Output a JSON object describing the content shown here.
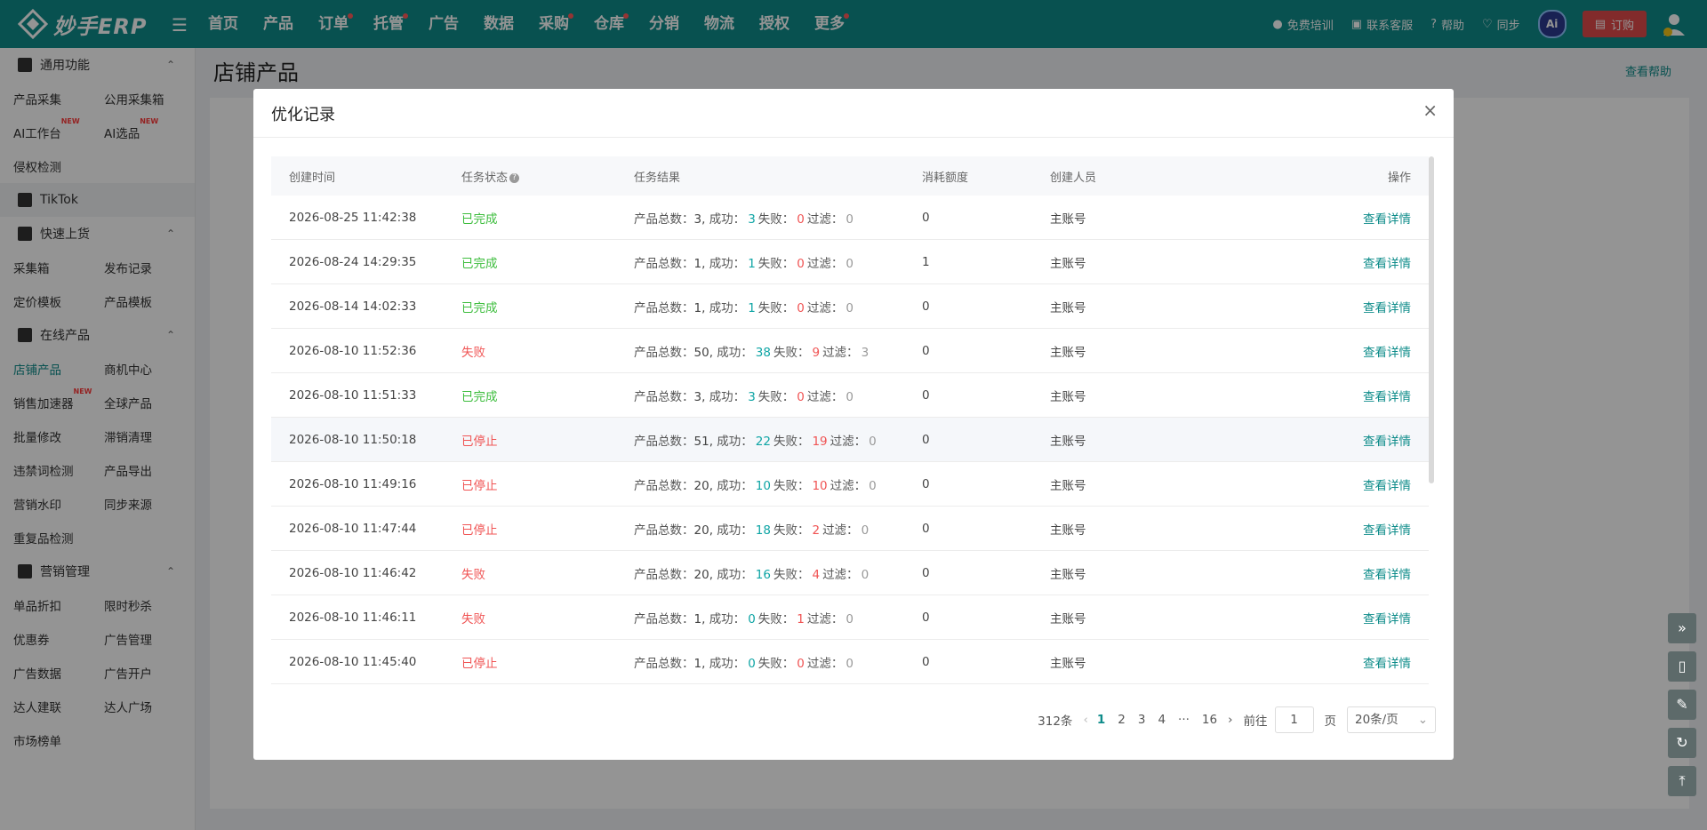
{
  "topbar": {
    "logo_text": "妙手ERP",
    "nav": [
      {
        "label": "首页",
        "dot": false
      },
      {
        "label": "产品",
        "dot": false
      },
      {
        "label": "订单",
        "dot": true
      },
      {
        "label": "托管",
        "dot": true
      },
      {
        "label": "广告",
        "dot": false
      },
      {
        "label": "数据",
        "dot": false
      },
      {
        "label": "采购",
        "dot": true
      },
      {
        "label": "仓库",
        "dot": true
      },
      {
        "label": "分销",
        "dot": false
      },
      {
        "label": "物流",
        "dot": false
      },
      {
        "label": "授权",
        "dot": false
      },
      {
        "label": "更多",
        "dot": true
      }
    ],
    "right": {
      "training": "免费培训",
      "service": "联系客服",
      "help": "帮助",
      "sync": "同步",
      "ai": "Ai",
      "order": "订购"
    }
  },
  "sidebar": {
    "sections": [
      {
        "title": "通用功能",
        "rows": [
          [
            "产品采集",
            "公用采集箱"
          ],
          [
            "AI工作台",
            "AI选品"
          ],
          [
            "侵权检测"
          ]
        ],
        "new": [
          "AI工作台",
          "AI选品"
        ]
      },
      {
        "title": "TikTok",
        "rows": []
      },
      {
        "title": "快速上货",
        "rows": [
          [
            "采集箱",
            "发布记录"
          ],
          [
            "定价模板",
            "产品模板"
          ]
        ]
      },
      {
        "title": "在线产品",
        "rows": [
          [
            "店铺产品",
            "商机中心"
          ],
          [
            "销售加速器",
            "全球产品"
          ],
          [
            "批量修改",
            "滞销清理"
          ],
          [
            "违禁词检测",
            "产品导出"
          ],
          [
            "营销水印",
            "同步来源"
          ],
          [
            "重复品检测"
          ]
        ],
        "new": [
          "销售加速器"
        ]
      },
      {
        "title": "营销管理",
        "rows": [
          [
            "单品折扣",
            "限时秒杀"
          ],
          [
            "优惠券",
            "广告管理"
          ],
          [
            "广告数据",
            "广告开户"
          ],
          [
            "达人建联",
            "达人广场"
          ],
          [
            "市场榜单"
          ]
        ]
      }
    ],
    "active": "店铺产品",
    "new_label": "NEW"
  },
  "page": {
    "title": "店铺产品",
    "help": "查看帮助"
  },
  "modal": {
    "title": "优化记录",
    "headers": {
      "time": "创建时间",
      "status": "任务状态",
      "result": "任务结果",
      "quota": "消耗额度",
      "creator": "创建人员",
      "action": "操作"
    },
    "result_labels": {
      "total": "产品总数：",
      "success": "成功：",
      "fail": "失败：",
      "filter": "过滤："
    },
    "rows": [
      {
        "time": "2026-08-25 11:42:38",
        "status": "已完成",
        "kind": "done",
        "total": "3",
        "success": "3",
        "fail": "0",
        "filter": "0",
        "quota": "0",
        "creator": "主账号",
        "action": "查看详情"
      },
      {
        "time": "2026-08-24 14:29:35",
        "status": "已完成",
        "kind": "done",
        "total": "1",
        "success": "1",
        "fail": "0",
        "filter": "0",
        "quota": "1",
        "creator": "主账号",
        "action": "查看详情"
      },
      {
        "time": "2026-08-14 14:02:33",
        "status": "已完成",
        "kind": "done",
        "total": "1",
        "success": "1",
        "fail": "0",
        "filter": "0",
        "quota": "0",
        "creator": "主账号",
        "action": "查看详情"
      },
      {
        "time": "2026-08-10 11:52:36",
        "status": "失败",
        "kind": "fail",
        "total": "50",
        "success": "38",
        "fail": "9",
        "filter": "3",
        "quota": "0",
        "creator": "主账号",
        "action": "查看详情"
      },
      {
        "time": "2026-08-10 11:51:33",
        "status": "已完成",
        "kind": "done",
        "total": "3",
        "success": "3",
        "fail": "0",
        "filter": "0",
        "quota": "0",
        "creator": "主账号",
        "action": "查看详情"
      },
      {
        "time": "2026-08-10 11:50:18",
        "status": "已停止",
        "kind": "fail",
        "total": "51",
        "success": "22",
        "fail": "19",
        "filter": "0",
        "quota": "0",
        "creator": "主账号",
        "action": "查看详情"
      },
      {
        "time": "2026-08-10 11:49:16",
        "status": "已停止",
        "kind": "fail",
        "total": "20",
        "success": "10",
        "fail": "10",
        "filter": "0",
        "quota": "0",
        "creator": "主账号",
        "action": "查看详情"
      },
      {
        "time": "2026-08-10 11:47:44",
        "status": "已停止",
        "kind": "fail",
        "total": "20",
        "success": "18",
        "fail": "2",
        "filter": "0",
        "quota": "0",
        "creator": "主账号",
        "action": "查看详情"
      },
      {
        "time": "2026-08-10 11:46:42",
        "status": "失败",
        "kind": "fail",
        "total": "20",
        "success": "16",
        "fail": "4",
        "filter": "0",
        "quota": "0",
        "creator": "主账号",
        "action": "查看详情"
      },
      {
        "time": "2026-08-10 11:46:11",
        "status": "失败",
        "kind": "fail",
        "total": "1",
        "success": "0",
        "fail": "1",
        "filter": "0",
        "quota": "0",
        "creator": "主账号",
        "action": "查看详情"
      },
      {
        "time": "2026-08-10 11:45:40",
        "status": "已停止",
        "kind": "fail",
        "total": "1",
        "success": "0",
        "fail": "0",
        "filter": "0",
        "quota": "0",
        "creator": "主账号",
        "action": "查看详情"
      }
    ],
    "hover_row": 5,
    "pager": {
      "total": "312条",
      "pages": [
        "1",
        "2",
        "3",
        "4",
        "16"
      ],
      "active": "1",
      "ellipsis": "···",
      "goto": "前往",
      "goto_value": "1",
      "page_unit": "页",
      "size": "20条/页"
    }
  },
  "colors": {
    "brand": "#0e8c8a",
    "done": "#3dbd3d",
    "fail": "#f05454"
  }
}
